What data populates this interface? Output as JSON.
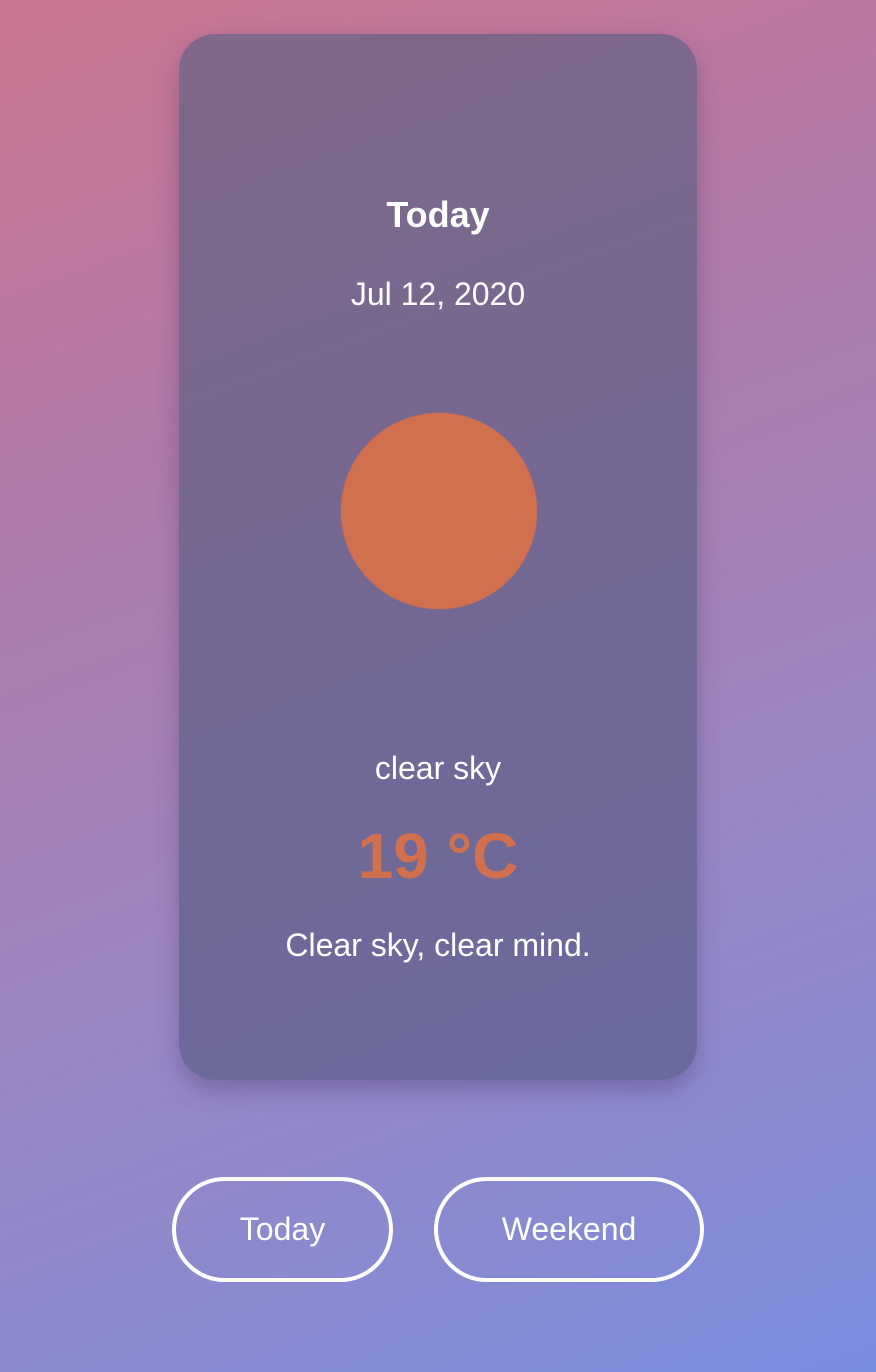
{
  "card": {
    "title": "Today",
    "date": "Jul 12, 2020",
    "icon": "sun-icon",
    "condition": "clear sky",
    "temperature": "19 °C",
    "message": "Clear sky, clear mind."
  },
  "buttons": {
    "today_label": "Today",
    "weekend_label": "Weekend"
  },
  "colors": {
    "accent": "#d0704e",
    "text": "#ffffff",
    "card": "#756892"
  }
}
